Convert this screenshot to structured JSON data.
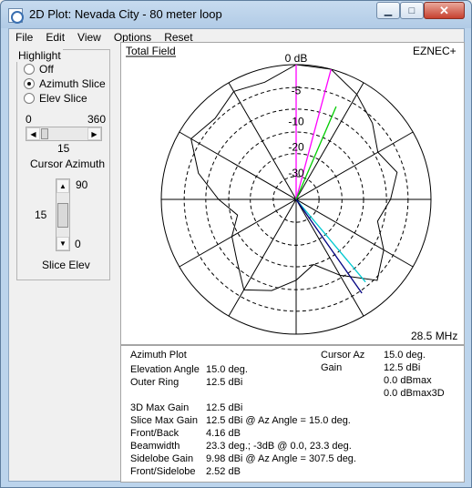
{
  "window": {
    "title": "2D Plot: Nevada City - 80 meter loop",
    "min_glyph": "▁",
    "max_glyph": "□",
    "close_glyph": "✕"
  },
  "menu": [
    "File",
    "Edit",
    "View",
    "Options",
    "Reset"
  ],
  "left_panel": {
    "highlight_label": "Highlight",
    "radios": [
      {
        "label": "Off",
        "checked": false
      },
      {
        "label": "Azimuth Slice",
        "checked": true
      },
      {
        "label": "Elev Slice",
        "checked": false
      }
    ],
    "az_min": "0",
    "az_max": "360",
    "az_value": "15",
    "cursor_azimuth_label": "Cursor Azimuth",
    "elev_top": "90",
    "elev_value": "15",
    "elev_bottom": "0",
    "slice_elev_label": "Slice Elev"
  },
  "plot": {
    "tab": "Total Field",
    "brand": "EZNEC+",
    "ring_labels": [
      "0 dB",
      "-5",
      "-10",
      "-20",
      "-30"
    ],
    "frequency": "28.5 MHz"
  },
  "chart_data": {
    "type": "polar",
    "azimuth_deg": [
      0,
      15,
      30,
      45,
      60,
      75,
      90,
      105,
      120,
      135,
      150,
      165,
      180,
      195,
      210,
      225,
      240,
      255,
      270,
      285,
      300,
      315,
      330,
      345
    ],
    "gain_db_rel_outer": [
      0,
      0,
      -4,
      -8,
      -12,
      -9,
      -12,
      -15,
      -10,
      -6,
      -14,
      -20,
      -16,
      -12,
      -9,
      -15,
      -18,
      -22,
      -17,
      -10,
      -4,
      -6,
      -3,
      -4
    ],
    "cursor_az_deg": 15,
    "beam_edges_deg": [
      0,
      23.3
    ],
    "outer_ring_dbi": 12.5
  },
  "info": {
    "left": [
      {
        "label": "Azimuth Plot",
        "value": ""
      },
      {
        "label": "Elevation Angle",
        "value": "15.0 deg."
      },
      {
        "label": "Outer Ring",
        "value": "12.5 dBi"
      },
      {
        "label": "3D Max Gain",
        "value": "12.5 dBi"
      },
      {
        "label": "Slice Max Gain",
        "value": "12.5 dBi @ Az Angle = 15.0 deg."
      },
      {
        "label": "Front/Back",
        "value": "4.16 dB"
      },
      {
        "label": "Beamwidth",
        "value": "23.3 deg.; -3dB @ 0.0, 23.3 deg."
      },
      {
        "label": "Sidelobe Gain",
        "value": "9.98 dBi @ Az Angle = 307.5 deg."
      },
      {
        "label": "Front/Sidelobe",
        "value": "2.52 dB"
      }
    ],
    "right": [
      {
        "label": "Cursor Az",
        "value": "15.0 deg."
      },
      {
        "label": "Gain",
        "value": "12.5 dBi"
      },
      {
        "label": "",
        "value": "0.0 dBmax"
      },
      {
        "label": "",
        "value": "0.0 dBmax3D"
      }
    ]
  }
}
